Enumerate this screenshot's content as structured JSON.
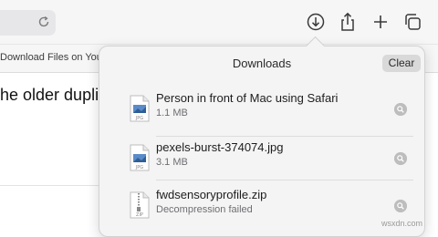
{
  "toolbar": {
    "reload_icon": "reload-icon",
    "downloads_icon": "download-arrow-icon",
    "share_icon": "share-icon",
    "new_tab_icon": "plus-icon",
    "tab_overview_icon": "tabs-icon"
  },
  "favorites": {
    "item_label": "Download Files on You"
  },
  "page": {
    "heading_fragment": "he older duplic"
  },
  "downloads": {
    "title": "Downloads",
    "clear_label": "Clear",
    "items": [
      {
        "name": "Person in front of Mac using Safari",
        "status": "1.1 MB",
        "icon": "jpg-file-icon",
        "badge": "JPG"
      },
      {
        "name": "pexels-burst-374074.jpg",
        "status": "3.1 MB",
        "icon": "jpg-file-icon",
        "badge": "JPG"
      },
      {
        "name": "fwdsensoryprofile.zip",
        "status": "Decompression failed",
        "icon": "zip-file-icon",
        "badge": "ZIP"
      }
    ]
  },
  "watermark": "wsxdn.com",
  "colors": {
    "toolbar_bg": "#f6f6f6",
    "popover_bg": "#f4f4f4",
    "secondary_text": "#6e6e73"
  }
}
